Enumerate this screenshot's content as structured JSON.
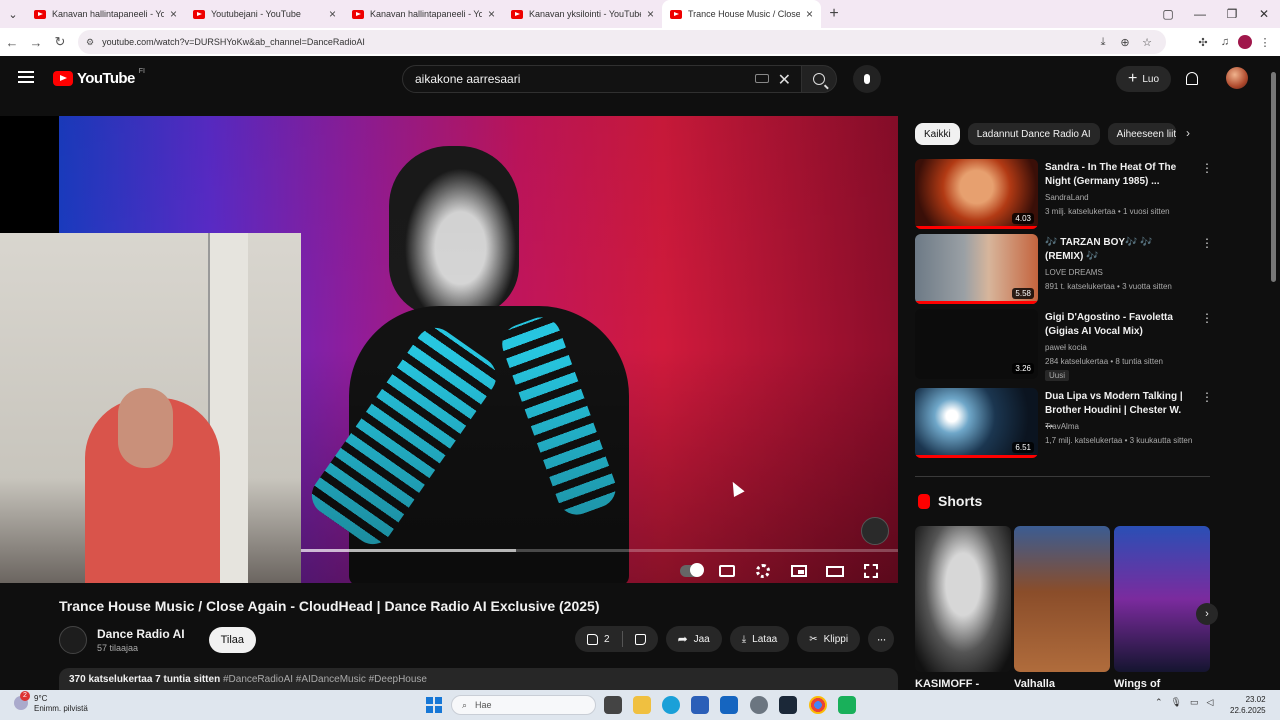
{
  "browser": {
    "tabs": [
      {
        "title": "Kanavan hallintapaneeli - YouT",
        "active": false
      },
      {
        "title": "Youtubejani - YouTube",
        "active": false
      },
      {
        "title": "Kanavan hallintapaneeli - YouT",
        "active": false
      },
      {
        "title": "Kanavan yksilointi - YouTube St",
        "active": false
      },
      {
        "title": "Trance House Music / Close Ag",
        "active": true
      }
    ],
    "new_tab": "+",
    "url": "youtube.com/watch?v=DURSHYoKw&ab_channel=DanceRadioAI"
  },
  "header": {
    "logo": "YouTube",
    "region": "FI",
    "search_value": "aikakone aarresaari",
    "create_label": "Luo"
  },
  "player": {
    "progress_fraction": 0.36
  },
  "video": {
    "title": "Trance House Music / Close Again - CloudHead | Dance Radio AI Exclusive (2025)",
    "channel": "Dance Radio AI",
    "subscribers": "57 tilaajaa",
    "subscribe_label": "Tilaa",
    "likes": "2",
    "share_label": "Jaa",
    "download_label": "Lataa",
    "clip_label": "Klippi",
    "views": "370 katselukertaa  7 tuntia sitten",
    "hashtags": "#DanceRadioAI #AIDanceMusic #DeepHouse"
  },
  "sidebar": {
    "chips": [
      "Kaikki",
      "Ladannut Dance Radio AI",
      "Aiheeseen liit"
    ],
    "recommendations": [
      {
        "title": "Sandra - In The Heat Of The Night (Germany 1985) ...",
        "channel": "SandraLand",
        "meta": "3 milj. katselukertaa • 1 vuosi sitten",
        "duration": "4.03",
        "badge": ""
      },
      {
        "title": "🎶 TARZAN BOY🎶 🎶 (REMIX) 🎶",
        "channel": "LOVE DREAMS",
        "meta": "891 t. katselukertaa • 3 vuotta sitten",
        "duration": "5.58",
        "badge": ""
      },
      {
        "title": "Gigi D'Agostino - Favoletta (Gigias AI Vocal Mix)",
        "channel": "paweł kocia",
        "meta": "284 katselukertaa • 8 tuntia sitten",
        "duration": "3.26",
        "badge": "Uusi"
      },
      {
        "title": "Dua Lipa vs Modern Talking | Brother Houdini | Chester W. ...",
        "channel": "TravAlma",
        "meta": "1,7 milj. katselukertaa • 3 kuukautta sitten",
        "duration": "6.51",
        "badge": ""
      }
    ],
    "shorts_title": "Shorts",
    "shorts": [
      {
        "title": "KASIMOFF -"
      },
      {
        "title": "Valhalla"
      },
      {
        "title": "Wings of"
      }
    ]
  },
  "taskbar": {
    "weather_temp": "9°C",
    "weather_text": "Enimm. pilvistä",
    "weather_badge": "2",
    "search_placeholder": "Hae",
    "time": "23.02",
    "date": "22.6.2025"
  },
  "colors": {
    "background": "#0f0f0f",
    "accent": "#ff0000",
    "chip_active": "#f1f1f1"
  }
}
